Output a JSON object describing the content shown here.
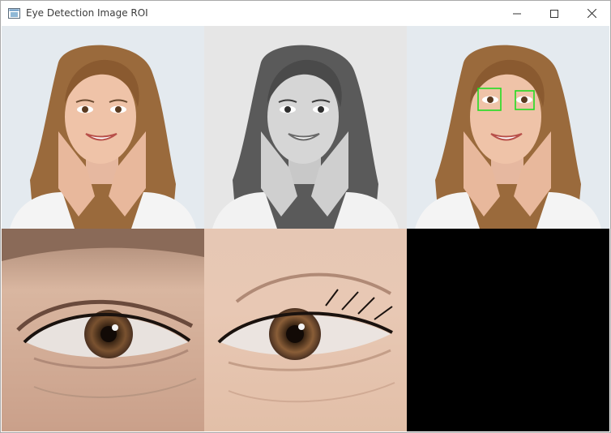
{
  "window": {
    "title": "Eye Detection Image ROI",
    "icon": "opencv-window-icon",
    "controls": [
      "minimize-icon",
      "maximize-icon",
      "close-icon"
    ]
  },
  "panels": [
    {
      "name": "original-color-face"
    },
    {
      "name": "grayscale-face"
    },
    {
      "name": "detected-eyes-face",
      "box_color": "#22dd22",
      "boxes_count": 2
    },
    {
      "name": "eye-roi-1"
    },
    {
      "name": "eye-roi-2"
    },
    {
      "name": "empty-black-panel"
    }
  ]
}
